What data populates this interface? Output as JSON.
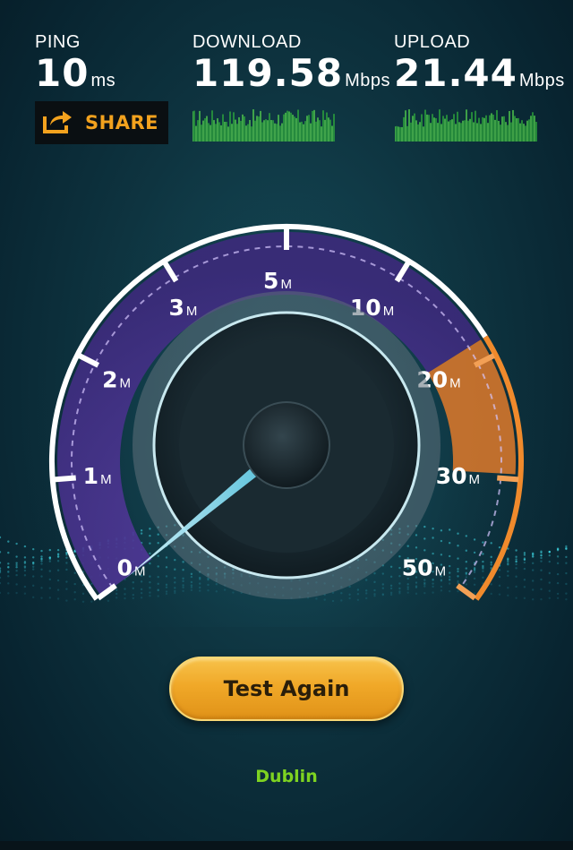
{
  "metrics": {
    "ping": {
      "label": "PING",
      "value": "10",
      "unit": "ms"
    },
    "download": {
      "label": "DOWNLOAD",
      "value": "119.58",
      "unit": "Mbps"
    },
    "upload": {
      "label": "UPLOAD",
      "value": "21.44",
      "unit": "Mbps"
    }
  },
  "share": {
    "label": "SHARE",
    "icon": "share-icon",
    "color": "#f3a21e"
  },
  "gauge": {
    "ticks": [
      {
        "value": "0",
        "unit": "M"
      },
      {
        "value": "1",
        "unit": "M"
      },
      {
        "value": "2",
        "unit": "M"
      },
      {
        "value": "3",
        "unit": "M"
      },
      {
        "value": "5",
        "unit": "M"
      },
      {
        "value": "10",
        "unit": "M"
      },
      {
        "value": "20",
        "unit": "M"
      },
      {
        "value": "30",
        "unit": "M"
      },
      {
        "value": "50",
        "unit": "M"
      }
    ],
    "needle_value_mbps": 0,
    "accent_color": "#f08a2c",
    "arc_color": "#7b4fc4"
  },
  "actions": {
    "test_again_label": "Test Again"
  },
  "location": {
    "name": "Dublin",
    "color": "#7ed321"
  }
}
